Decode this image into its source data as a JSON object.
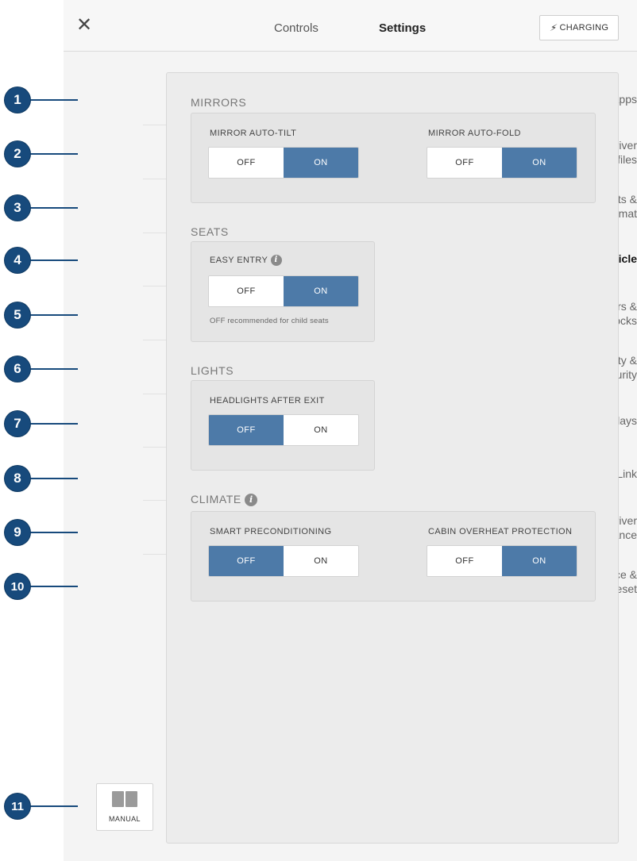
{
  "topbar": {
    "close_glyph": "✕",
    "tabs": [
      "Controls",
      "Settings"
    ],
    "active_tab": "Settings",
    "charging_icon": "plug-bolt-icon",
    "charging_label": "CHARGING"
  },
  "sidebar": {
    "items": [
      {
        "label": "Apps",
        "active": false
      },
      {
        "label": "Driver\nProfiles",
        "active": false
      },
      {
        "label": "Units &\nFormat",
        "active": false
      },
      {
        "label": "Vehicle",
        "active": true
      },
      {
        "label": "Doors &\nLocks",
        "active": false
      },
      {
        "label": "Safety &\nSecurity",
        "active": false
      },
      {
        "label": "Displays",
        "active": false
      },
      {
        "label": "HomeLink",
        "active": false
      },
      {
        "label": "Driver\nAssistance",
        "active": false
      },
      {
        "label": "Service &\nReset",
        "active": false
      }
    ],
    "manual_label": "MANUAL",
    "manual_icon": "book-icon"
  },
  "sections": {
    "mirrors": {
      "title": "MIRRORS",
      "auto_tilt": {
        "label": "MIRROR AUTO-TILT",
        "off": "OFF",
        "on": "ON",
        "value": "ON"
      },
      "auto_fold": {
        "label": "MIRROR AUTO-FOLD",
        "off": "OFF",
        "on": "ON",
        "value": "ON"
      }
    },
    "seats": {
      "title": "SEATS",
      "easy_entry": {
        "label": "EASY ENTRY",
        "off": "OFF",
        "on": "ON",
        "value": "ON",
        "note": "OFF recommended for child seats"
      }
    },
    "lights": {
      "title": "LIGHTS",
      "headlights": {
        "label": "HEADLIGHTS AFTER EXIT",
        "off": "OFF",
        "on": "ON",
        "value": "OFF"
      }
    },
    "climate": {
      "title": "CLIMATE",
      "smart_precond": {
        "label": "SMART PRECONDITIONING",
        "off": "OFF",
        "on": "ON",
        "value": "OFF"
      },
      "overheat": {
        "label": "CABIN OVERHEAT PROTECTION",
        "off": "OFF",
        "on": "ON",
        "value": "ON"
      }
    }
  },
  "callouts": [
    "1",
    "2",
    "3",
    "4",
    "5",
    "6",
    "7",
    "8",
    "9",
    "10",
    "11"
  ],
  "colors": {
    "accent": "#4d7aa8",
    "callout": "#174a7c"
  }
}
